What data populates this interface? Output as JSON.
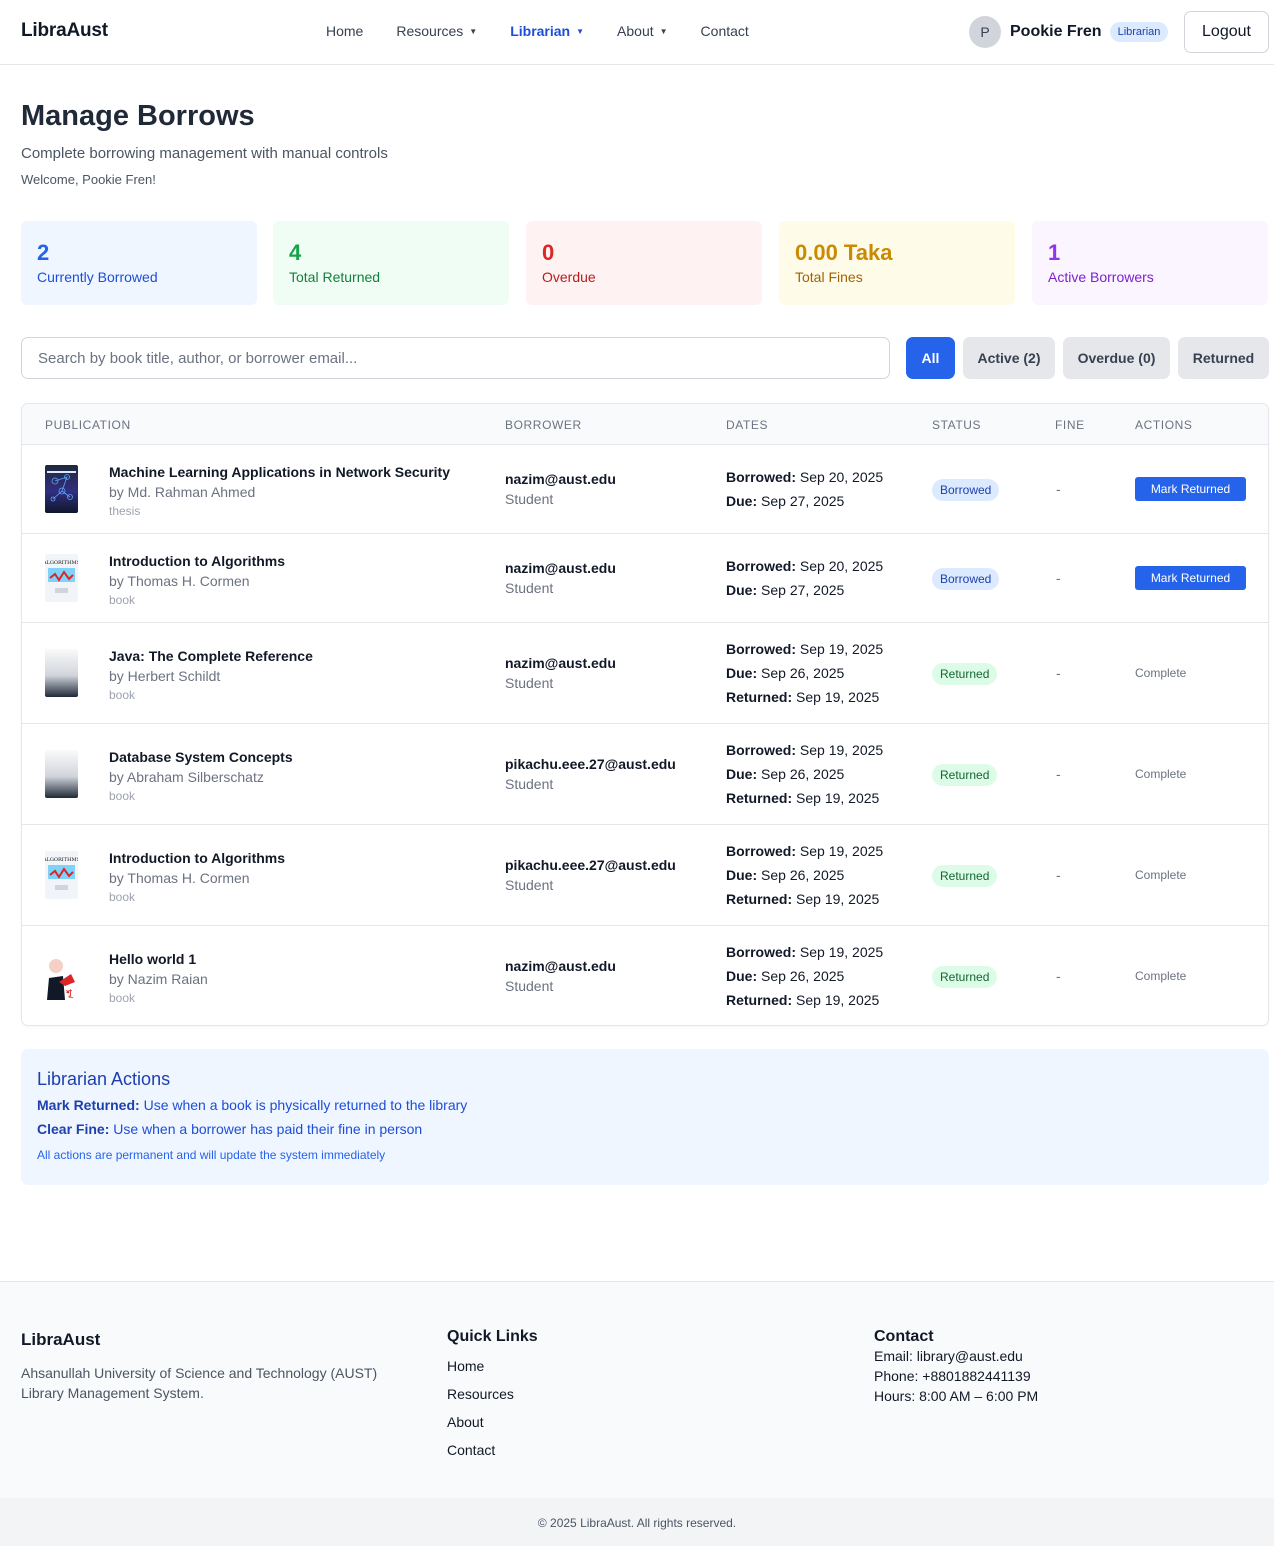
{
  "nav": {
    "brand": "LibraAust",
    "links": [
      {
        "label": "Home"
      },
      {
        "label": "Resources"
      },
      {
        "label": "Librarian"
      },
      {
        "label": "About"
      },
      {
        "label": "Contact"
      }
    ],
    "user": {
      "initial": "P",
      "name": "Pookie Fren",
      "role": "Librarian"
    },
    "logout_label": "Logout"
  },
  "header": {
    "title": "Manage Borrows",
    "subtitle": "Complete borrowing management with manual controls",
    "welcome": "Welcome, Pookie Fren!"
  },
  "stats": [
    {
      "value": "2",
      "label": "Currently Borrowed"
    },
    {
      "value": "4",
      "label": "Total Returned"
    },
    {
      "value": "0",
      "label": "Overdue"
    },
    {
      "value": "0.00 Taka",
      "label": "Total Fines"
    },
    {
      "value": "1",
      "label": "Active Borrowers"
    }
  ],
  "search": {
    "placeholder": "Search by book title, author, or borrower email..."
  },
  "filters": [
    "All",
    "Active (2)",
    "Overdue (0)",
    "Returned"
  ],
  "table": {
    "headers": [
      "Publication",
      "Borrower",
      "Dates",
      "Status",
      "Fine",
      "Actions"
    ],
    "labels": {
      "borrowed": "Borrowed:",
      "due": "Due:",
      "returned": "Returned:"
    },
    "rows": [
      {
        "title": "Machine Learning Applications in Network Security",
        "author": "by Md. Rahman Ahmed",
        "type": "thesis",
        "email": "nazim@aust.edu",
        "role": "Student",
        "borrowed": "Sep 20, 2025",
        "due": "Sep 27, 2025",
        "returned": "",
        "status": "Borrowed",
        "fine": "-",
        "action": "Mark Returned"
      },
      {
        "title": "Introduction to Algorithms",
        "author": "by Thomas H. Cormen",
        "type": "book",
        "email": "nazim@aust.edu",
        "role": "Student",
        "borrowed": "Sep 20, 2025",
        "due": "Sep 27, 2025",
        "returned": "",
        "status": "Borrowed",
        "fine": "-",
        "action": "Mark Returned"
      },
      {
        "title": "Java: The Complete Reference",
        "author": "by Herbert Schildt",
        "type": "book",
        "email": "nazim@aust.edu",
        "role": "Student",
        "borrowed": "Sep 19, 2025",
        "due": "Sep 26, 2025",
        "returned": "Sep 19, 2025",
        "status": "Returned",
        "fine": "-",
        "action": "Complete"
      },
      {
        "title": "Database System Concepts",
        "author": "by Abraham Silberschatz",
        "type": "book",
        "email": "pikachu.eee.27@aust.edu",
        "role": "Student",
        "borrowed": "Sep 19, 2025",
        "due": "Sep 26, 2025",
        "returned": "Sep 19, 2025",
        "status": "Returned",
        "fine": "-",
        "action": "Complete"
      },
      {
        "title": "Introduction to Algorithms",
        "author": "by Thomas H. Cormen",
        "type": "book",
        "email": "pikachu.eee.27@aust.edu",
        "role": "Student",
        "borrowed": "Sep 19, 2025",
        "due": "Sep 26, 2025",
        "returned": "Sep 19, 2025",
        "status": "Returned",
        "fine": "-",
        "action": "Complete"
      },
      {
        "title": "Hello world 1",
        "author": "by Nazim Raian",
        "type": "book",
        "email": "nazim@aust.edu",
        "role": "Student",
        "borrowed": "Sep 19, 2025",
        "due": "Sep 26, 2025",
        "returned": "Sep 19, 2025",
        "status": "Returned",
        "fine": "-",
        "action": "Complete"
      }
    ]
  },
  "librarian_actions": {
    "title": "Librarian Actions",
    "mark_label": "Mark Returned:",
    "mark_text": " Use when a book is physically returned to the library",
    "clear_label": "Clear Fine:",
    "clear_text": " Use when a borrower has paid their fine in person",
    "note": "All actions are permanent and will update the system immediately"
  },
  "footer": {
    "brand": "LibraAust",
    "description": "Ahsanullah University of Science and Technology (AUST) Library Management System.",
    "quick_links_title": "Quick Links",
    "quick_links": [
      "Home",
      "Resources",
      "About",
      "Contact"
    ],
    "contact_title": "Contact",
    "email": "Email: library@aust.edu",
    "phone": "Phone: +8801882441139",
    "hours": "Hours: 8:00 AM – 6:00 PM",
    "copyright": "© 2025 LibraAust. All rights reserved."
  },
  "colors": {
    "accent": "#2563eb",
    "borrowed_badge": "#dbeafe",
    "returned_badge": "#dcfce7"
  }
}
